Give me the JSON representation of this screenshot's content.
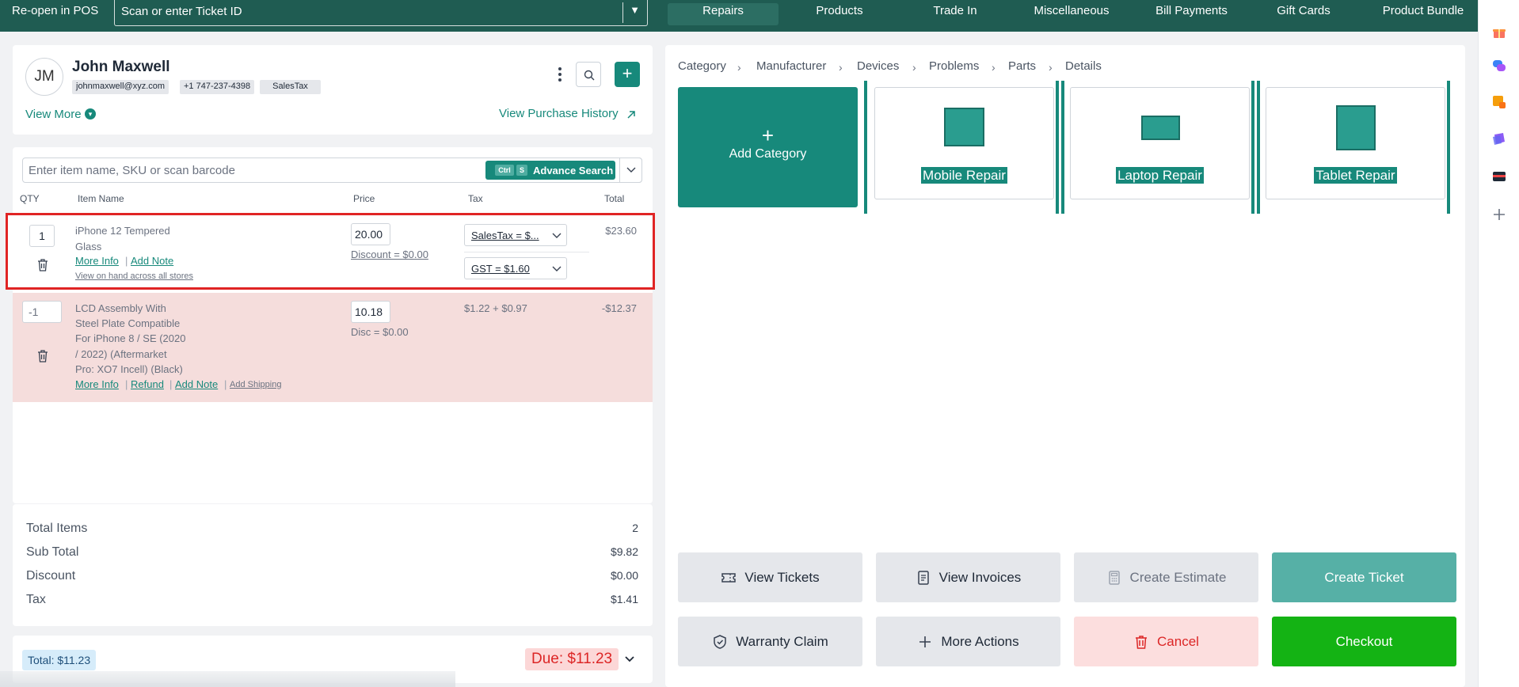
{
  "topbar": {
    "reopen_label": "Re-open in POS",
    "ticket_placeholder": "Scan or enter Ticket ID",
    "tabs": [
      {
        "label": "Repairs",
        "active": true
      },
      {
        "label": "Products",
        "active": false
      },
      {
        "label": "Trade In",
        "active": false
      },
      {
        "label": "Miscellaneous",
        "active": false
      },
      {
        "label": "Bill Payments",
        "active": false
      },
      {
        "label": "Gift Cards",
        "active": false
      },
      {
        "label": "Product Bundle",
        "active": false
      }
    ]
  },
  "customer": {
    "initials": "JM",
    "name": "John Maxwell",
    "email": "johnmaxwell@xyz.com",
    "phone": "+1 747-237-4398",
    "tax_tag": "SalesTax",
    "view_more": "View More",
    "purchase_history": "View Purchase History"
  },
  "cart": {
    "search_placeholder": "Enter item name, SKU or scan barcode",
    "advance_search": "Advance Search",
    "kbd_ctrl": "Ctrl",
    "kbd_s": "S",
    "columns": {
      "qty": "QTY",
      "item": "Item Name",
      "price": "Price",
      "tax": "Tax",
      "total": "Total"
    },
    "rows": [
      {
        "qty": "1",
        "name_lines": [
          "iPhone 12 Tempered",
          "Glass"
        ],
        "more_info": "More Info",
        "add_note": "Add Note",
        "view_on_hand": "View on hand across all stores",
        "price": "20.00",
        "discount": "Discount = $0.00",
        "tax_1": "SalesTax = $...",
        "tax_2": "GST = $1.60",
        "total": "$23.60"
      },
      {
        "qty": "-1",
        "name_lines": [
          "LCD Assembly With",
          "Steel Plate Compatible",
          "For iPhone 8 / SE (2020",
          "/ 2022) (Aftermarket",
          "Pro: XO7 Incell) (Black)"
        ],
        "more_info": "More Info",
        "refund": "Refund",
        "add_note": "Add Note",
        "add_shipping": "Add Shipping",
        "price": "10.18",
        "discount": "Disc = $0.00",
        "tax": "$1.22 + $0.97",
        "total": "-$12.37"
      }
    ]
  },
  "totals": {
    "total_items_label": "Total Items",
    "total_items": "2",
    "subtotal_label": "Sub Total",
    "subtotal": "$9.82",
    "discount_label": "Discount",
    "discount": "$0.00",
    "tax_label": "Tax",
    "tax": "$1.41"
  },
  "footer": {
    "total": "Total: $11.23",
    "due": "Due: $11.23"
  },
  "catalog": {
    "breadcrumb": [
      "Category",
      "Manufacturer",
      "Devices",
      "Problems",
      "Parts",
      "Details"
    ],
    "add_category": "Add Category",
    "tiles": [
      {
        "label": "Mobile Repair"
      },
      {
        "label": "Laptop Repair"
      },
      {
        "label": "Tablet Repair"
      }
    ]
  },
  "actions": {
    "view_tickets": "View Tickets",
    "view_invoices": "View Invoices",
    "create_estimate": "Create Estimate",
    "create_ticket": "Create Ticket",
    "warranty_claim": "Warranty Claim",
    "more_actions": "More Actions",
    "cancel": "Cancel",
    "checkout": "Checkout"
  },
  "colors": {
    "brand_dark": "#1f5c52",
    "accent": "#17897b",
    "checkout": "#14b314",
    "cancel": "#dc2626",
    "highlight_border": "#e02424",
    "refund_row_bg": "#f5dddc"
  }
}
